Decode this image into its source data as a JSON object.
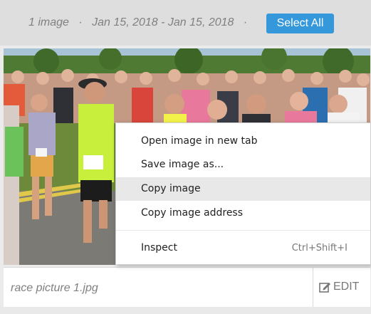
{
  "header": {
    "image_count": "1 image",
    "separator": "·",
    "date_range": "Jan 15, 2018 - Jan 15, 2018",
    "select_all_label": "Select All",
    "accent_color": "#3498db"
  },
  "photo": {
    "icon": "race-runners-photo"
  },
  "card": {
    "filename": "race picture 1.jpg",
    "edit_label": "EDIT",
    "edit_icon": "edit-icon"
  },
  "context_menu": {
    "items": [
      {
        "label": "Open image in new tab"
      },
      {
        "label": "Save image as..."
      },
      {
        "label": "Copy image"
      },
      {
        "label": "Copy image address"
      },
      {
        "label": "Inspect",
        "shortcut": "Ctrl+Shift+I"
      }
    ],
    "hovered_item": "Copy image"
  }
}
